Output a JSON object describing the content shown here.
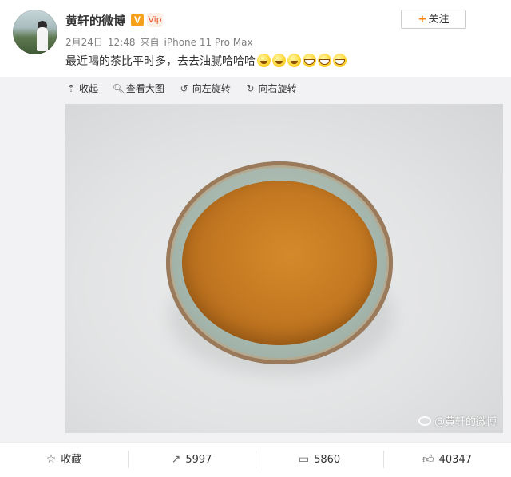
{
  "post": {
    "author": "黄轩的微博",
    "verified_mark": "V",
    "vip_mark": "Vip",
    "date": "2月24日",
    "time": "12:48",
    "source_prefix": "来自",
    "source_device": "iPhone 11 Pro Max",
    "text": "最近喝的茶比平时多，去去油腻哈哈哈",
    "emojis": [
      "laugh-emoji",
      "laugh-emoji",
      "laugh-emoji",
      "grin-emoji",
      "grin-emoji",
      "grin-emoji"
    ],
    "follow_label": "关注",
    "follow_icon": "+"
  },
  "media": {
    "toolbar": {
      "collapse": "收起",
      "view_large": "查看大图",
      "rotate_left": "向左旋转",
      "rotate_right": "向右旋转"
    },
    "watermark": "@黄轩的微博"
  },
  "actions": {
    "favorite_label": "收藏",
    "repost_count": "5997",
    "comment_count": "5860",
    "like_count": "40347"
  },
  "colors": {
    "accent": "#ff8200",
    "verified": "#f7a11a",
    "media_bg": "#f2f2f5"
  }
}
